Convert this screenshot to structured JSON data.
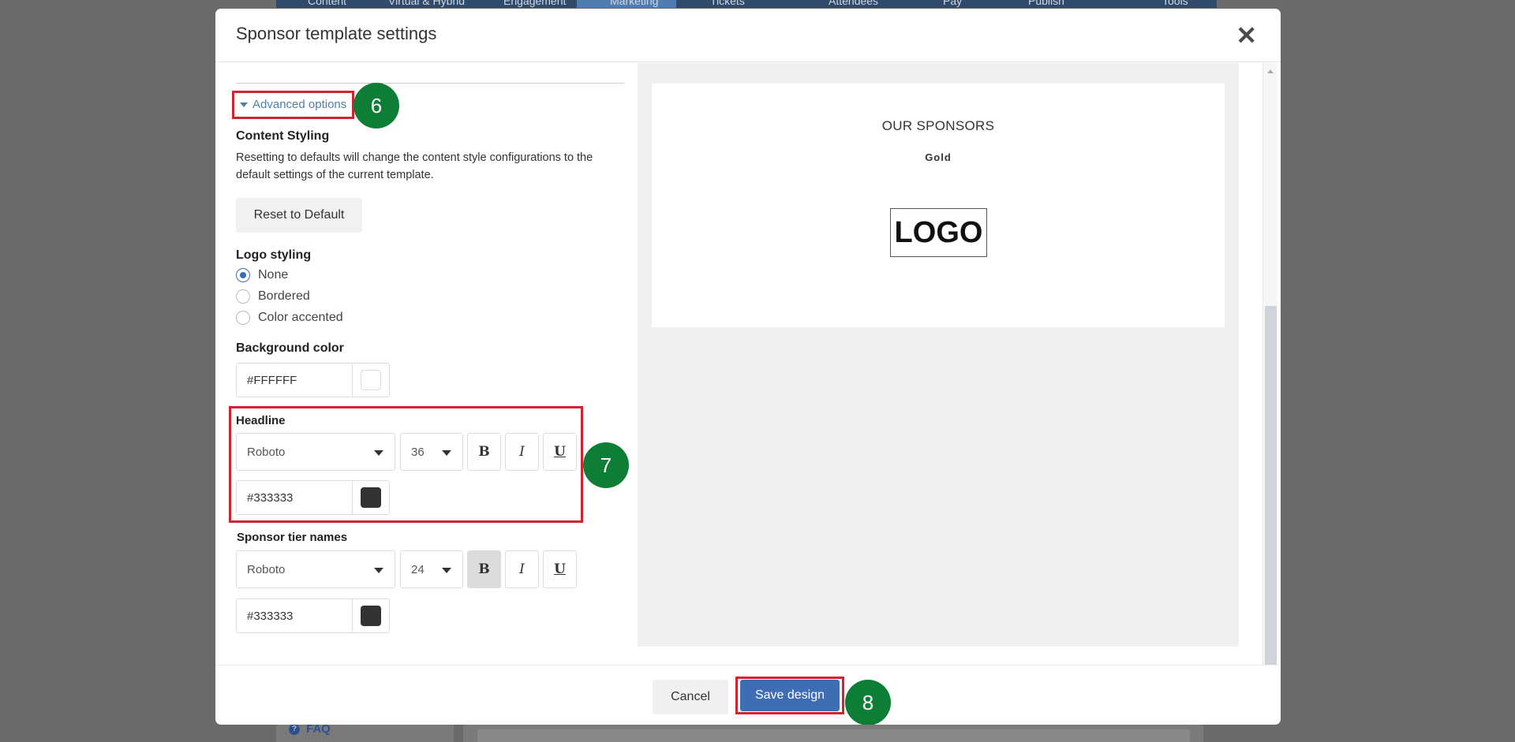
{
  "background": {
    "nav_items": [
      "Content",
      "Virtual & Hybrid",
      "Engagement",
      "Marketing",
      "Tickets",
      "Attendees",
      "Pay",
      "Publish",
      "Tools"
    ],
    "faq_label": "FAQ",
    "faq_icon": "?"
  },
  "modal": {
    "title": "Sponsor template settings",
    "close_glyph": "✕"
  },
  "left": {
    "advanced_options_label": "Advanced options",
    "content_styling": {
      "heading": "Content Styling",
      "description": "Resetting to defaults will change the content style configurations to the default settings of the current template.",
      "reset_label": "Reset to Default"
    },
    "logo_styling": {
      "heading": "Logo styling",
      "options": [
        "None",
        "Bordered",
        "Color accented"
      ],
      "selected": "None"
    },
    "background_color": {
      "heading": "Background color",
      "value": "#FFFFFF"
    },
    "headline": {
      "heading": "Headline",
      "font": "Roboto",
      "size": "36",
      "bold_glyph": "B",
      "italic_glyph": "I",
      "underline_glyph": "U",
      "bold_active": false,
      "color": "#333333"
    },
    "tier_names": {
      "heading": "Sponsor tier names",
      "font": "Roboto",
      "size": "24",
      "bold_glyph": "B",
      "italic_glyph": "I",
      "underline_glyph": "U",
      "bold_active": true,
      "color": "#333333"
    }
  },
  "preview": {
    "title": "OUR SPONSORS",
    "tier": "Gold",
    "logo_text": "LOGO"
  },
  "footer": {
    "cancel_label": "Cancel",
    "save_label": "Save design"
  },
  "step_badges": [
    "6",
    "7",
    "8"
  ],
  "colors": {
    "highlight_border": "#d3232f",
    "badge_green": "#0e7d35",
    "primary_blue": "#3f6db3"
  }
}
